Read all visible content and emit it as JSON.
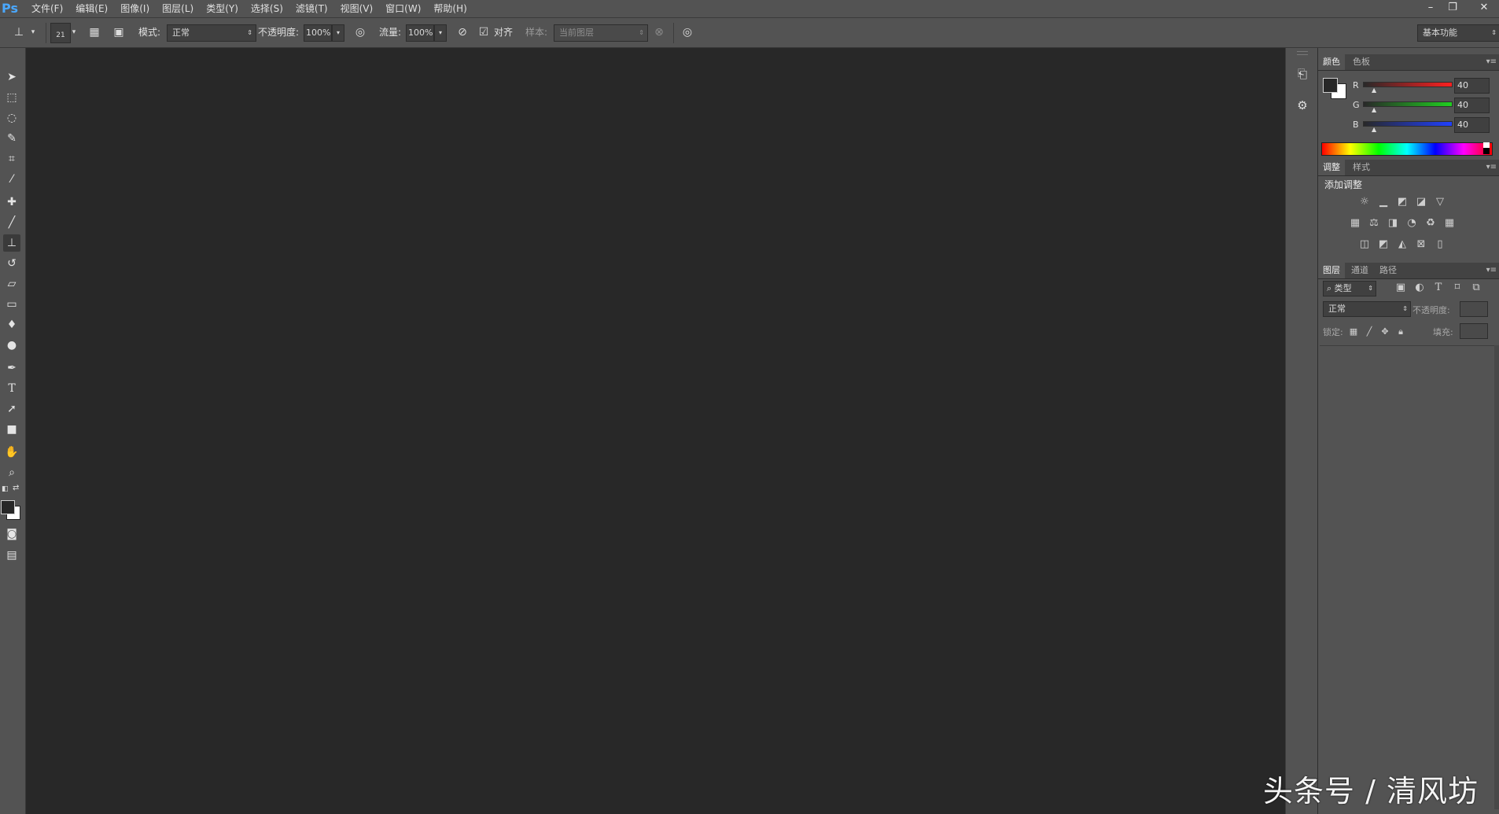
{
  "app": {
    "logo": "Ps"
  },
  "menu": [
    "文件(F)",
    "编辑(E)",
    "图像(I)",
    "图层(L)",
    "类型(Y)",
    "选择(S)",
    "滤镜(T)",
    "视图(V)",
    "窗口(W)",
    "帮助(H)"
  ],
  "window_controls": {
    "minimize": "–",
    "restore": "❐",
    "close": "✕"
  },
  "options": {
    "brush_size": "21",
    "mode_label": "模式:",
    "mode_value": "正常",
    "opacity_label": "不透明度:",
    "opacity_value": "100%",
    "flow_label": "流量:",
    "flow_value": "100%",
    "align_label": "对齐",
    "align_checked": true,
    "sample_label": "样本:",
    "sample_value": "当前图层",
    "workspace": "基本功能"
  },
  "tools": [
    "move-tool-icon",
    "marquee-tool-icon",
    "lasso-tool-icon",
    "quick-select-tool-icon",
    "crop-tool-icon",
    "eyedropper-tool-icon",
    "healing-brush-tool-icon",
    "brush-tool-icon",
    "clone-stamp-tool-icon",
    "history-brush-tool-icon",
    "eraser-tool-icon",
    "gradient-tool-icon",
    "blur-tool-icon",
    "dodge-tool-icon",
    "pen-tool-icon",
    "type-tool-icon",
    "path-select-tool-icon",
    "rectangle-tool-icon",
    "hand-tool-icon",
    "zoom-tool-icon"
  ],
  "color_panel": {
    "tabs": [
      "颜色",
      "色板"
    ],
    "r_label": "R",
    "g_label": "G",
    "b_label": "B",
    "r_value": "40",
    "g_value": "40",
    "b_value": "40",
    "foreground": "#282828",
    "background": "#ffffff"
  },
  "adjust_panel": {
    "tabs": [
      "调整",
      "样式"
    ],
    "title": "添加调整"
  },
  "layers_panel": {
    "tabs": [
      "图层",
      "通道",
      "路径"
    ],
    "filter_label": "类型",
    "blend_mode": "正常",
    "opacity_label": "不透明度:",
    "lock_label": "锁定:",
    "fill_label": "填充:"
  },
  "watermark": "头条号 / 清风坊"
}
